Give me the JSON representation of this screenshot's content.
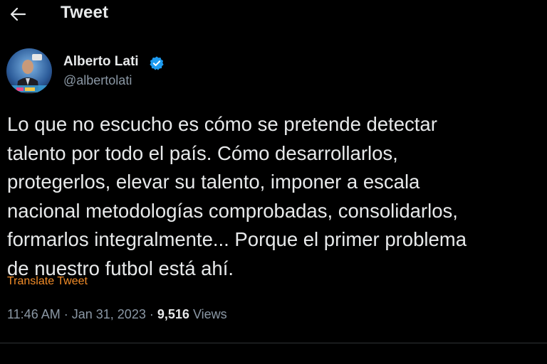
{
  "header": {
    "title": "Tweet",
    "back_icon": "arrow-left-icon"
  },
  "author": {
    "name": "Alberto Lati",
    "handle": "@albertolati",
    "verified_icon": "verified-badge-icon",
    "verified_color": "#1d9bf0"
  },
  "tweet": {
    "text": "Lo que no escucho es cómo se pretende detectar\ntalento por todo el país. Cómo desarrollarlos,\nprotegerlos, elevar su talento, imponer a escala\nnacional metodologías comprobadas, consolidarlos,\nformarlos integralmente... Porque el primer problema\nde nuestro futbol está ahí.",
    "translate_label": "Translate Tweet",
    "time": "11:46 AM",
    "date": "Jan 31, 2023",
    "views_count": "9,516",
    "views_label": "Views",
    "separator": "·"
  },
  "colors": {
    "background": "#000000",
    "text": "#e7e9ea",
    "secondary": "#8b98a5",
    "translate": "#f28c28"
  }
}
